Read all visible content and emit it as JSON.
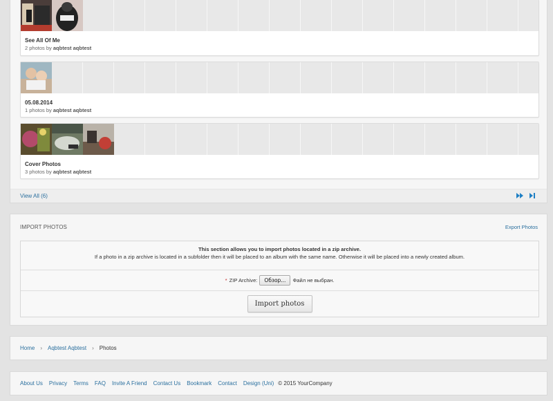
{
  "albums": [
    {
      "title": "See All Of Me",
      "count": "2 photos by",
      "owner": "aqbtest aqbtest"
    },
    {
      "title": "05.08.2014",
      "count": "1 photos by",
      "owner": "aqbtest aqbtest"
    },
    {
      "title": "Cover Photos",
      "count": "3 photos by",
      "owner": "aqbtest aqbtest"
    }
  ],
  "albums_footer": {
    "view_all": "View All (6)",
    "next_icon": "fast-forward-icon",
    "last_icon": "skip-to-end-icon"
  },
  "import": {
    "title": "IMPORT PHOTOS",
    "export_link": "Export Photos",
    "desc_bold": "This section allows you to import photos located in a zip archive.",
    "desc": "If a photo in a zip archive is located in a subfolder then it will be placed to an album with the same name. Otherwise it will be placed into a newly created album.",
    "required_mark": "*",
    "zip_label": "ZIP Archive:",
    "browse_button": "Обзор...",
    "no_file": "Файл не выбран.",
    "submit": "Import photos"
  },
  "breadcrumb": {
    "home": "Home",
    "user": "Aqbtest Aqbtest",
    "current": "Photos",
    "separator": "›"
  },
  "footer": {
    "links": [
      "About Us",
      "Privacy",
      "Terms",
      "FAQ",
      "Invite A Friend",
      "Contact Us",
      "Bookmark",
      "Contact",
      "Design (Uni)"
    ],
    "copyright": "© 2015 YourCompany"
  },
  "colors": {
    "link": "#2a6f9e",
    "panel": "#f6f6f6",
    "accent_arrow": "#1e7fc4"
  }
}
